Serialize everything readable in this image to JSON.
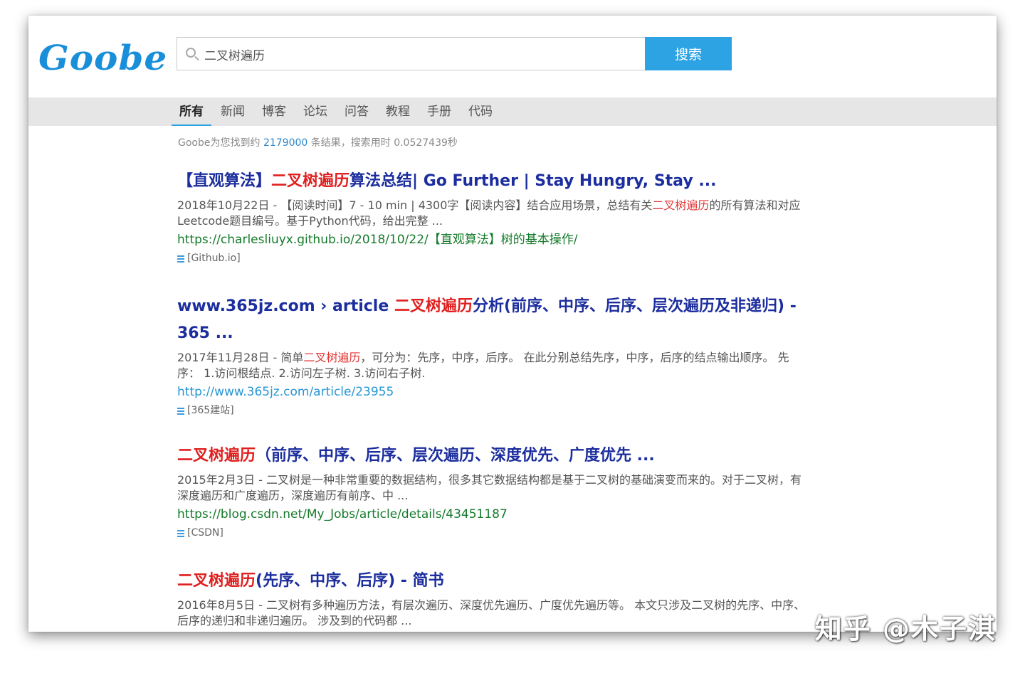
{
  "logo": "Goobe",
  "search": {
    "value": "二叉树遍历",
    "button_label": "搜索"
  },
  "tabs": [
    {
      "label": "所有"
    },
    {
      "label": "新闻"
    },
    {
      "label": "博客"
    },
    {
      "label": "论坛"
    },
    {
      "label": "问答"
    },
    {
      "label": "教程"
    },
    {
      "label": "手册"
    },
    {
      "label": "代码"
    }
  ],
  "stats": {
    "prefix": "Goobe为您找到约",
    "count": "2179000",
    "suffix": "条结果，搜索用时 0.0527439秒"
  },
  "results": [
    {
      "title_pre": "【直观算法】",
      "title_hl": "二叉树遍历",
      "title_post": "算法总结| Go Further | Stay Hungry, Stay ...",
      "snippet_pre": "2018年10月22日 - 【阅读时间】7 - 10 min | 4300字【阅读内容】结合应用场景，总结有关",
      "snippet_hl": "二叉树遍历",
      "snippet_post": "的所有算法和对应Leetcode题目编号。基于Python代码，给出完整 ...",
      "url": "https://charlesliuyx.github.io/2018/10/22/【直观算法】树的基本操作/",
      "source": "[Github.io]"
    },
    {
      "title_pre": "www.365jz.com › article ",
      "title_hl": "二叉树遍历",
      "title_post": "分析(前序、中序、后序、层次遍历及非递归) - 365 ...",
      "snippet_pre": "2017年11月28日 - 简单",
      "snippet_hl": "二叉树遍历",
      "snippet_post": "，可分为：先序，中序，后序。 在此分别总结先序，中序，后序的结点输出顺序。 先序： 1.访问根结点. 2.访问左子树. 3.访问右子树.",
      "url": "http://www.365jz.com/article/23955",
      "source": "[365建站]"
    },
    {
      "title_pre": "",
      "title_hl": "二叉树遍历",
      "title_post": "（前序、中序、后序、层次遍历、深度优先、广度优先 ...",
      "snippet_pre": "2015年2月3日 - 二叉树是一种非常重要的数据结构，很多其它数据结构都是基于二叉树的基础演变而来的。对于二叉树，有深度遍历和广度遍历，深度遍历有前序、中 ...",
      "snippet_hl": "",
      "snippet_post": "",
      "url": "https://blog.csdn.net/My_Jobs/article/details/43451187",
      "source": "[CSDN]"
    },
    {
      "title_pre": "",
      "title_hl": "二叉树遍历",
      "title_post": "(先序、中序、后序) - 简书",
      "snippet_pre": "2016年8月5日 - 二叉树有多种遍历方法，有层次遍历、深度优先遍历、广度优先遍历等。 本文只涉及二叉树的先序、中序、后序的递归和非递归遍历。 涉及到的代码都 ...",
      "snippet_hl": "",
      "snippet_post": "",
      "url": "",
      "source": ""
    }
  ],
  "watermark": "知乎 @木子淇",
  "colors": {
    "brand": "#1a8fd9",
    "button": "#2ea3e4",
    "title": "#1c2e9e",
    "highlight": "#e01f1f",
    "url_green": "#147a2a",
    "url_blue": "#2696d3"
  }
}
